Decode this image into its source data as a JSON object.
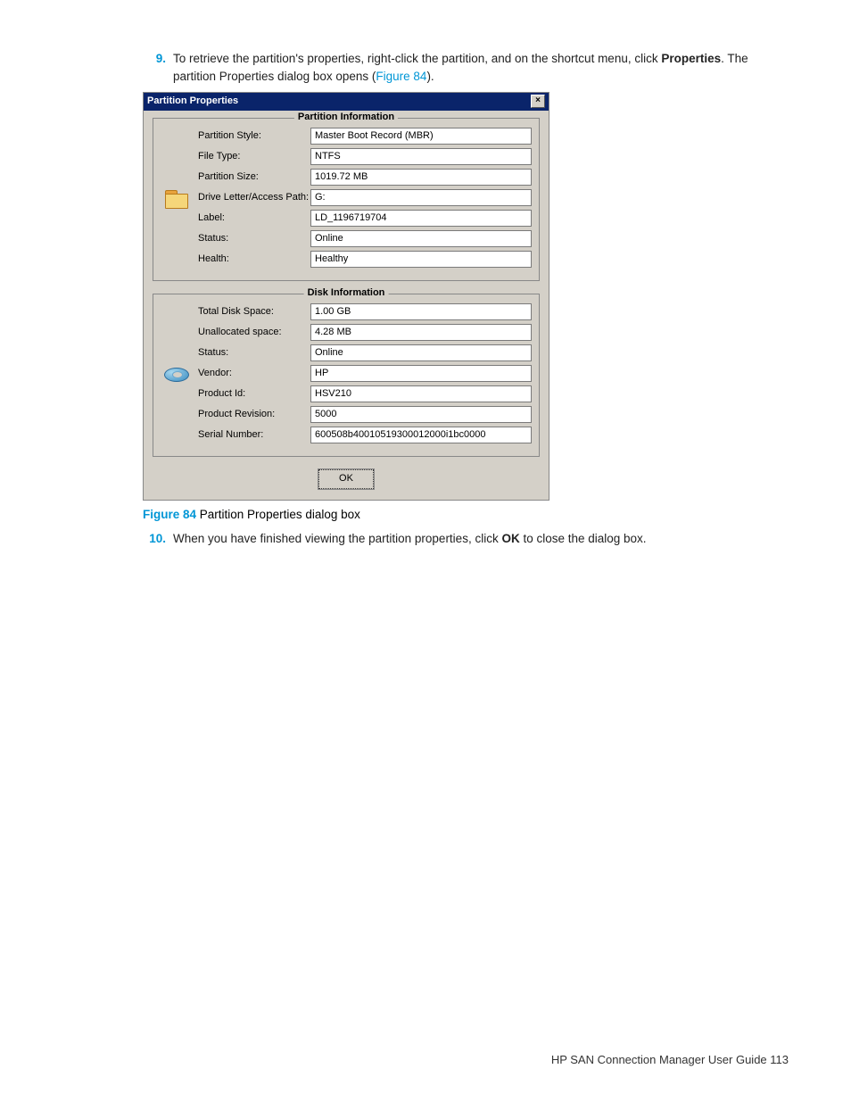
{
  "steps": {
    "s9_num": "9.",
    "s9_text_a": "To retrieve the partition's properties, right-click the partition, and on the shortcut menu, click ",
    "s9_bold": "Properties",
    "s9_text_b": ". The partition Properties dialog box opens (",
    "s9_link": "Figure 84",
    "s9_text_c": ").",
    "s10_num": "10.",
    "s10_text_a": "When you have finished viewing the partition properties, click ",
    "s10_bold": "OK",
    "s10_text_b": " to close the dialog box."
  },
  "dialog": {
    "title": "Partition Properties",
    "close": "×",
    "section1_title": "Partition Information",
    "section2_title": "Disk Information",
    "partition": {
      "l1": "Partition Style:",
      "v1": "Master Boot Record (MBR)",
      "l2": "File Type:",
      "v2": "NTFS",
      "l3": "Partition Size:",
      "v3": "1019.72 MB",
      "l4": "Drive Letter/Access Path:",
      "v4": "G:",
      "l5": "Label:",
      "v5": "LD_1196719704",
      "l6": "Status:",
      "v6": "Online",
      "l7": "Health:",
      "v7": "Healthy"
    },
    "disk": {
      "l1": "Total Disk Space:",
      "v1": "1.00 GB",
      "l2": "Unallocated space:",
      "v2": "4.28 MB",
      "l3": "Status:",
      "v3": "Online",
      "l4": "Vendor:",
      "v4": "HP",
      "l5": "Product Id:",
      "v5": "HSV210",
      "l6": "Product Revision:",
      "v6": "5000",
      "l7": "Serial Number:",
      "v7": "600508b40010519300012000i1bc0000"
    },
    "ok": "OK"
  },
  "caption": {
    "num": "Figure 84",
    "text": " Partition Properties dialog box"
  },
  "footer": {
    "text": "HP SAN Connection Manager User Guide   113"
  }
}
